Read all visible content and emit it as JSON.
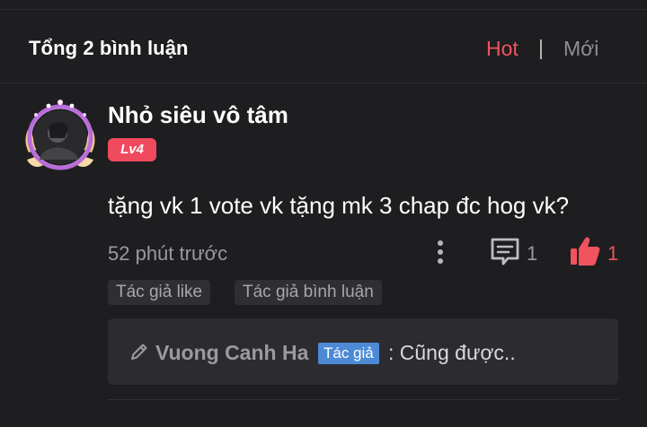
{
  "header": {
    "title": "Tổng 2 bình luận",
    "sort_hot": "Hot",
    "sort_separator": "|",
    "sort_new": "Mới"
  },
  "comment": {
    "username": "Nhỏ siêu vô tâm",
    "level": "Lv4",
    "text": "tặng vk 1 vote vk tặng mk 3 chap đc hog vk?",
    "timestamp": "52 phút trước",
    "reply_count": "1",
    "like_count": "1",
    "tags": [
      "Tác giả like",
      "Tác giả bình luận"
    ],
    "reply": {
      "author": "Vuong Canh Ha",
      "author_badge": "Tác giả",
      "text": ": Cũng được.."
    }
  },
  "colors": {
    "background": "#1e1e20",
    "accent": "#f0535e",
    "badge_blue": "#4c8ad6"
  },
  "icons": {
    "avatar": "avatar",
    "more": "more-vertical-icon",
    "reply": "comment-bubble-icon",
    "like": "thumbs-up-icon",
    "pencil": "pencil-icon"
  }
}
